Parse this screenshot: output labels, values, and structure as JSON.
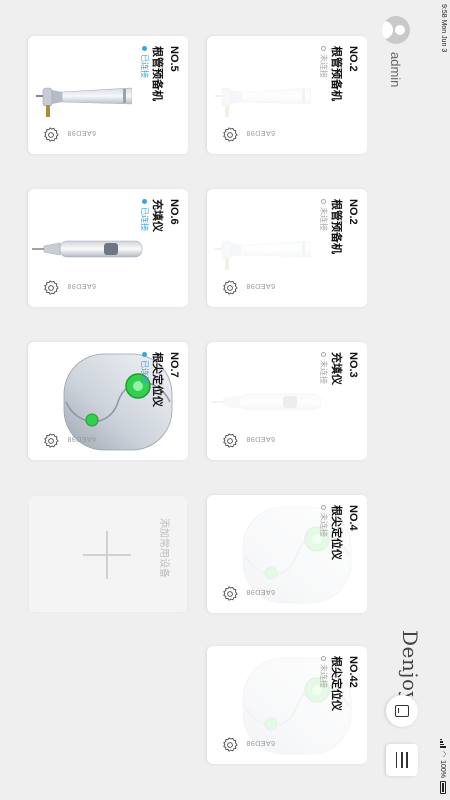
{
  "status_bar": {
    "time_date": "9:58 Mon Jun 3",
    "battery": "100%"
  },
  "user": {
    "name": "admin"
  },
  "brand": {
    "logo": "Denjoy",
    "mark": "®"
  },
  "add_card": {
    "label": "添加常用设备"
  },
  "devices": [
    {
      "no": "NO.2",
      "name": "根管预备机",
      "status": "未连接",
      "connected": false,
      "serial": "6AED98",
      "image": "handpiece"
    },
    {
      "no": "NO.5",
      "name": "根管预备机",
      "status": "已连接",
      "connected": true,
      "serial": "6AED98",
      "image": "handpiece"
    },
    {
      "no": "NO.2",
      "name": "根管预备机",
      "status": "未连接",
      "connected": false,
      "serial": "6AED98",
      "image": "handpiece"
    },
    {
      "no": "NO.6",
      "name": "充填仪",
      "status": "已连接",
      "connected": true,
      "serial": "6AED98",
      "image": "pen"
    },
    {
      "no": "NO.3",
      "name": "充填仪",
      "status": "未连接",
      "connected": false,
      "serial": "6AED98",
      "image": "pen"
    },
    {
      "no": "NO.7",
      "name": "根尖定位仪",
      "status": "已连接",
      "connected": true,
      "serial": "6AED98",
      "image": "locator"
    },
    {
      "no": "NO.4",
      "name": "根尖定位仪",
      "status": "未连接",
      "connected": false,
      "serial": "6AED98",
      "image": "locator"
    },
    {
      "no": "NO.42",
      "name": "根尖定位仪",
      "status": "未连接",
      "connected": false,
      "serial": "6AED98",
      "image": "locator"
    }
  ],
  "colors": {
    "connected": "#3aa6d8",
    "led": "#2fd24a"
  }
}
